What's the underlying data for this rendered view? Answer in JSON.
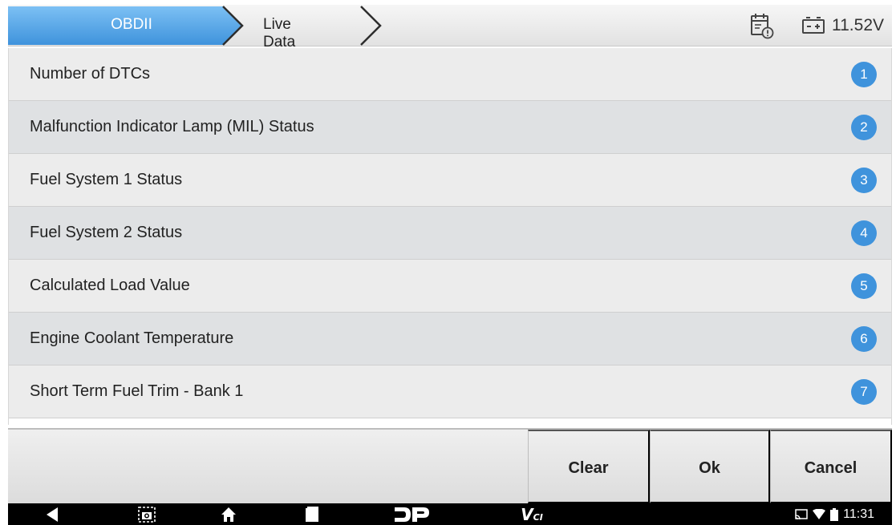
{
  "breadcrumb": {
    "items": [
      {
        "label": "OBDII",
        "active": true
      },
      {
        "label": "Live Data",
        "active": false
      }
    ]
  },
  "status": {
    "voltage": "11.52V",
    "icons": [
      "calendar-alert-icon",
      "battery-icon"
    ]
  },
  "list": {
    "items": [
      {
        "label": "Number of DTCs",
        "number": "1"
      },
      {
        "label": "Malfunction Indicator Lamp (MIL) Status",
        "number": "2"
      },
      {
        "label": "Fuel System 1 Status",
        "number": "3"
      },
      {
        "label": "Fuel System 2 Status",
        "number": "4"
      },
      {
        "label": "Calculated Load Value",
        "number": "5"
      },
      {
        "label": "Engine Coolant Temperature",
        "number": "6"
      },
      {
        "label": "Short Term Fuel Trim - Bank 1",
        "number": "7"
      }
    ]
  },
  "actions": {
    "clear": "Clear",
    "ok": "Ok",
    "cancel": "Cancel"
  },
  "navbar": {
    "icons": [
      "back-icon",
      "screenshot-icon",
      "home-icon",
      "recent-apps-icon",
      "dp-logo-icon",
      "vci-icon"
    ],
    "vci_label": "V",
    "vci_sub": "CI",
    "time": "11:31"
  },
  "colors": {
    "accent": "#3f93dc",
    "tab_active": "#4a9fe6",
    "row_odd": "#ececec",
    "row_even": "#dfe1e3"
  }
}
